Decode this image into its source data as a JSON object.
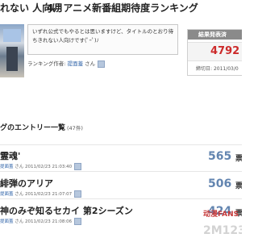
{
  "page": {
    "title_part1": "れない 人向け",
    "title_part2": "4月アニメ新番組期待度ランキング"
  },
  "header": {
    "description_line1": "いずれ公式でもやるとは思いますけど、タイトルのとおり待",
    "description_line2": "ちきれない人向けです(ﾟｰﾟ)ﾉ",
    "author_label": "ランキング作者:",
    "author_name": "提面蓋",
    "author_suffix": "さん"
  },
  "results": {
    "heading": "結果発表済",
    "total_votes": "4792",
    "deadline_label": "締切日:",
    "deadline_value": "2011/03/0"
  },
  "entry_list": {
    "heading": "グのエントリー一覧",
    "count": "(47件)",
    "entries": [
      {
        "title": "霊魂'",
        "user": "提面蓋",
        "user_suffix": "さん",
        "date": "2011/02/23 21:03:40",
        "votes": "565",
        "unit": "票"
      },
      {
        "title": "緋弾のアリア",
        "user": "提面蓋",
        "user_suffix": "さん",
        "date": "2011/02/23 21:07:07",
        "votes": "506",
        "unit": "票"
      },
      {
        "title": "神のみぞ知るセカイ 第2シーズン",
        "user": "提面蓋",
        "user_suffix": "さん",
        "date": "2011/02/23 21:08:06",
        "votes": "424",
        "unit": "票"
      }
    ]
  },
  "watermark": {
    "logo": "动漫FANS",
    "site": "2M123"
  }
}
